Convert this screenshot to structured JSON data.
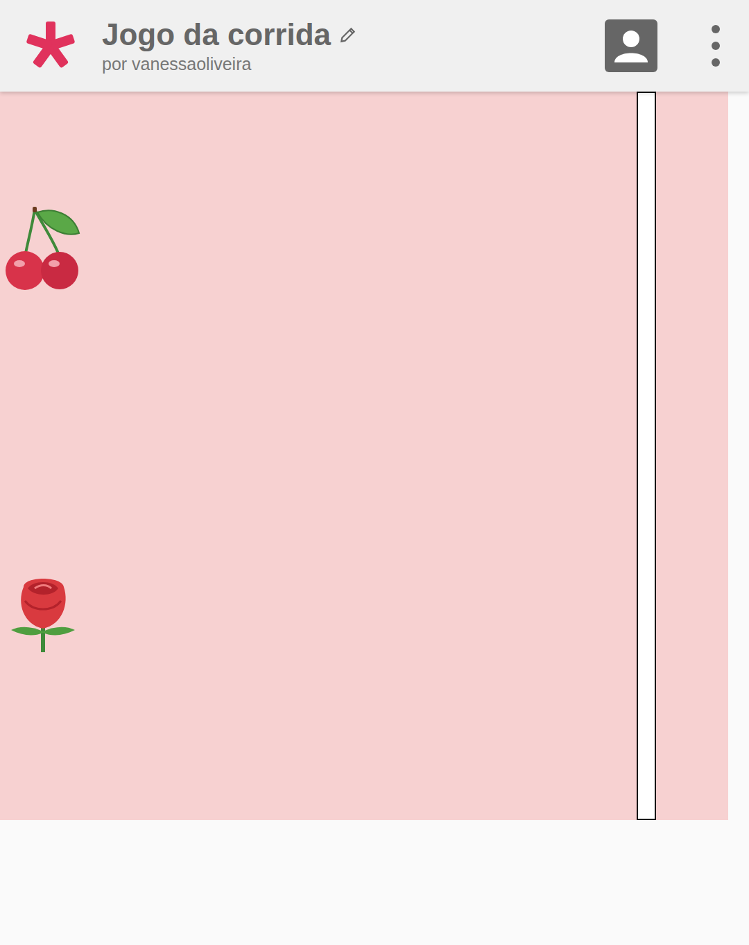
{
  "header": {
    "title": "Jogo da corrida",
    "author": "por vanessaoliveira"
  },
  "racers": [
    {
      "kind": "cherry"
    },
    {
      "kind": "rose"
    }
  ]
}
